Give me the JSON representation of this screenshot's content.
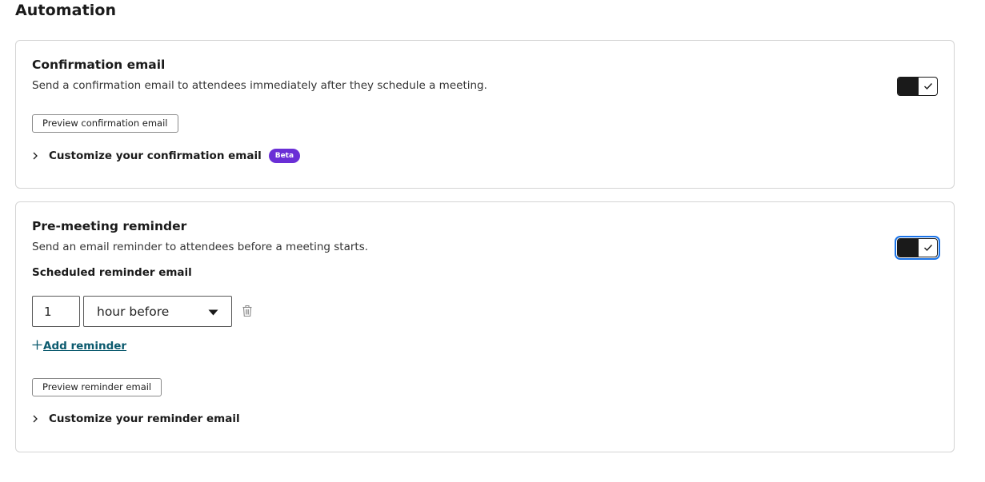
{
  "page": {
    "title": "Automation"
  },
  "confirmation": {
    "title": "Confirmation email",
    "description": "Send a confirmation email to attendees immediately after they schedule a meeting.",
    "toggle_on": true,
    "preview_label": "Preview confirmation email",
    "customize_label": "Customize your confirmation email",
    "badge": "Beta"
  },
  "reminder": {
    "title": "Pre-meeting reminder",
    "description": "Send an email reminder to attendees before a meeting starts.",
    "toggle_on": true,
    "scheduled_heading": "Scheduled reminder email",
    "amount_value": "1",
    "unit_value": "hour before",
    "add_label": "Add reminder",
    "preview_label": "Preview reminder email",
    "customize_label": "Customize your reminder email"
  },
  "colors": {
    "badge": "#6a2fd6",
    "link": "#0b5a6e",
    "toggle": "#1a1a1a",
    "focus": "#1a73e8"
  },
  "icons": [
    "check-icon",
    "chevron-right-icon",
    "caret-down-icon",
    "trash-icon",
    "plus-icon"
  ]
}
